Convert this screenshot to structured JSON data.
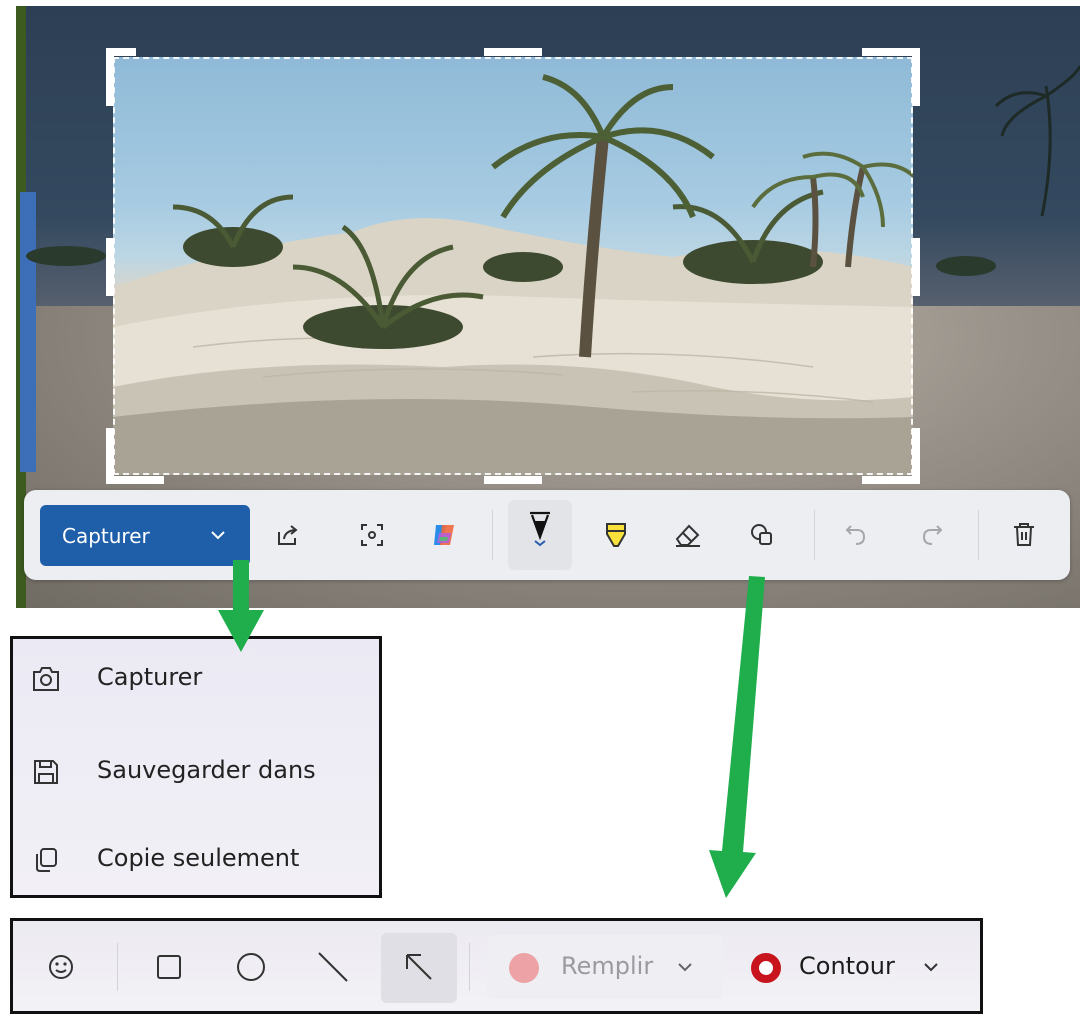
{
  "toolbar": {
    "capture_label": "Capturer",
    "icons": [
      "share-icon",
      "text-extract-icon",
      "copilot-icon",
      "pen-icon",
      "highlighter-icon",
      "eraser-icon",
      "shapes-icon",
      "undo-icon",
      "redo-icon",
      "delete-icon"
    ],
    "active_tool": "pen-icon",
    "accent_color": "#1f5faa"
  },
  "capture_menu": {
    "items": [
      {
        "label": "Capturer",
        "icon": "camera-icon"
      },
      {
        "label": "Sauvegarder dans",
        "icon": "save-icon"
      },
      {
        "label": "Copie seulement",
        "icon": "copy-icon"
      }
    ]
  },
  "shapes_toolbar": {
    "icons": [
      "emoji-icon",
      "rectangle-icon",
      "circle-icon",
      "line-icon",
      "arrow-icon"
    ],
    "active_shape": "arrow-icon",
    "fill_label": "Remplir",
    "fill_color": "#eda3a6",
    "contour_label": "Contour",
    "contour_color": "#c8151d"
  },
  "annotation_color": "#1fae4b"
}
